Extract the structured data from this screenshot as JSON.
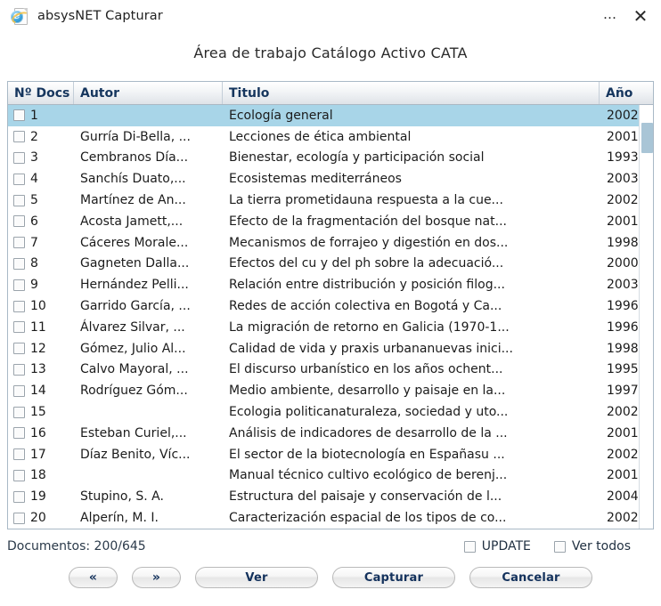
{
  "window": {
    "title": "absysNET Capturar",
    "icon": "ie-document-icon",
    "more_label": "…",
    "close_label": "✕"
  },
  "heading": {
    "label": "Área de trabajo",
    "value": "Catálogo Activo CATA"
  },
  "table": {
    "columns": [
      {
        "key": "num",
        "label": "Nº Docs"
      },
      {
        "key": "autor",
        "label": "Autor"
      },
      {
        "key": "titulo",
        "label": "Titulo"
      },
      {
        "key": "anio",
        "label": "Año"
      }
    ],
    "rows": [
      {
        "num": "1",
        "autor": "",
        "titulo": "Ecología general",
        "anio": "2002",
        "selected": true,
        "checked": false
      },
      {
        "num": "2",
        "autor": "Gurría Di-Bella, ...",
        "titulo": "Lecciones de ética ambiental",
        "anio": "2001",
        "selected": false,
        "checked": false
      },
      {
        "num": "3",
        "autor": "Cembranos Día...",
        "titulo": "Bienestar, ecología y participación social",
        "anio": "1993",
        "selected": false,
        "checked": false
      },
      {
        "num": "4",
        "autor": "Sanchís Duato,...",
        "titulo": "Ecosistemas mediterráneos",
        "anio": "2003",
        "selected": false,
        "checked": false
      },
      {
        "num": "5",
        "autor": "Martínez de An...",
        "titulo": "La tierra prometidauna respuesta a la cue...",
        "anio": "2002",
        "selected": false,
        "checked": false
      },
      {
        "num": "6",
        "autor": "Acosta Jamett,...",
        "titulo": "Efecto de la fragmentación del bosque nat...",
        "anio": "2001",
        "selected": false,
        "checked": false
      },
      {
        "num": "7",
        "autor": "Cáceres Morale...",
        "titulo": "Mecanismos de forrajeo y digestión en dos...",
        "anio": "1998",
        "selected": false,
        "checked": false
      },
      {
        "num": "8",
        "autor": "Gagneten Dalla...",
        "titulo": "Efectos del cu y del ph sobre la adecuació...",
        "anio": "2000",
        "selected": false,
        "checked": false
      },
      {
        "num": "9",
        "autor": "Hernández Pelli...",
        "titulo": "Relación entre distribución y posición filog...",
        "anio": "2003",
        "selected": false,
        "checked": false
      },
      {
        "num": "10",
        "autor": "Garrido García, ...",
        "titulo": "Redes de acción colectiva en Bogotá y Ca...",
        "anio": "1996",
        "selected": false,
        "checked": false
      },
      {
        "num": "11",
        "autor": "Álvarez Silvar, ...",
        "titulo": "La migración de retorno en Galicia (1970-1...",
        "anio": "1996",
        "selected": false,
        "checked": false
      },
      {
        "num": "12",
        "autor": "Gómez, Julio Al...",
        "titulo": "Calidad de vida y praxis urbananuevas inici...",
        "anio": "1998",
        "selected": false,
        "checked": false
      },
      {
        "num": "13",
        "autor": "Calvo Mayoral, ...",
        "titulo": "El discurso urbanístico en los años ochent...",
        "anio": "1995",
        "selected": false,
        "checked": false
      },
      {
        "num": "14",
        "autor": "Rodríguez Góm...",
        "titulo": "Medio ambiente, desarrollo y paisaje en la...",
        "anio": "1997",
        "selected": false,
        "checked": false
      },
      {
        "num": "15",
        "autor": "",
        "titulo": "Ecologia politicanaturaleza, sociedad y uto...",
        "anio": "2002",
        "selected": false,
        "checked": false
      },
      {
        "num": "16",
        "autor": "Esteban Curiel,...",
        "titulo": "Análisis de indicadores de desarrollo de la ...",
        "anio": "2001",
        "selected": false,
        "checked": false
      },
      {
        "num": "17",
        "autor": "Díaz Benito, Víc...",
        "titulo": "El sector de la biotecnología en Españasu ...",
        "anio": "2002",
        "selected": false,
        "checked": false
      },
      {
        "num": "18",
        "autor": "",
        "titulo": "Manual técnico cultivo ecológico de berenj...",
        "anio": "2001",
        "selected": false,
        "checked": false
      },
      {
        "num": "19",
        "autor": "Stupino, S. A.",
        "titulo": "Estructura del paisaje y conservación de l...",
        "anio": "2004",
        "selected": false,
        "checked": false
      },
      {
        "num": "20",
        "autor": "Alperín, M. I.",
        "titulo": "Caracterización espacial de los tipos de co...",
        "anio": "2002",
        "selected": false,
        "checked": false
      }
    ]
  },
  "status": {
    "documents": "Documentos: 200/645",
    "update_label": "UPDATE",
    "update_checked": false,
    "ver_todos_label": "Ver todos",
    "ver_todos_checked": false
  },
  "buttons": {
    "first": "«",
    "next": "»",
    "ver": "Ver",
    "capturar": "Capturar",
    "cancelar": "Cancelar"
  },
  "colors": {
    "selection": "#a8d5e8",
    "header_text": "#16365e",
    "panel_border": "#a9b9c6",
    "scroll_thumb": "#a9c5d6"
  }
}
